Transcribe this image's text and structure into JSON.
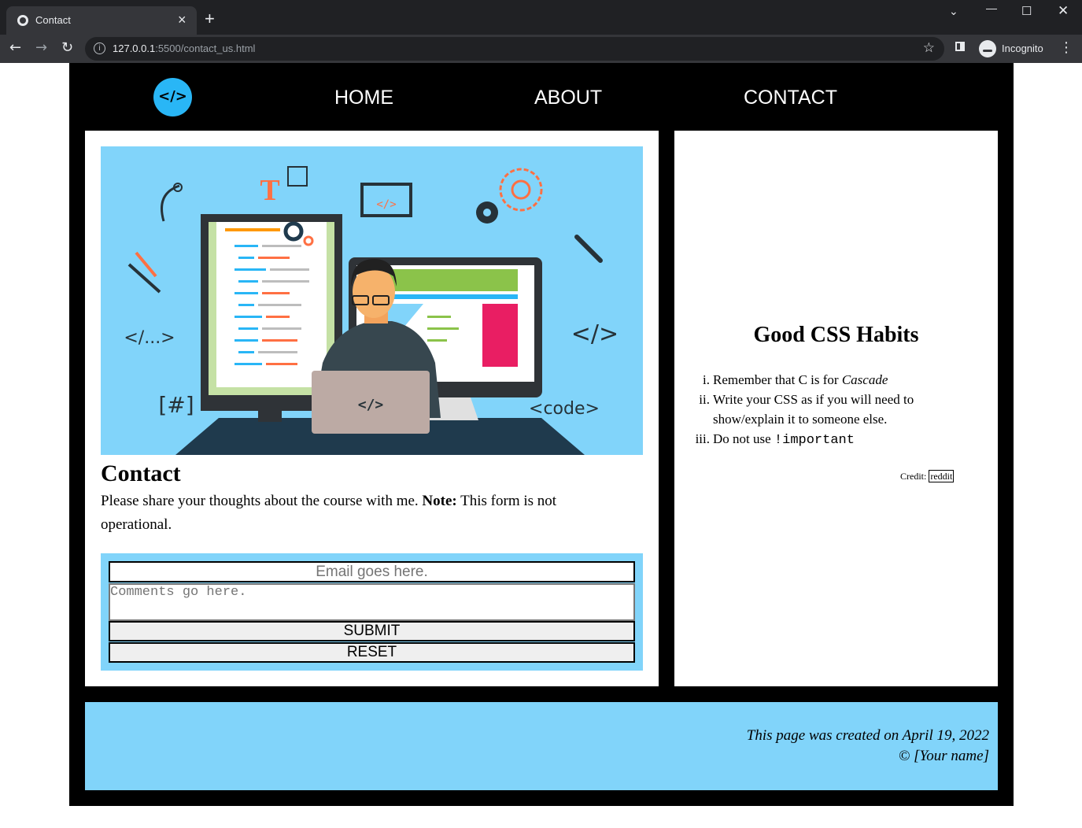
{
  "browser": {
    "tab_title": "Contact",
    "tab_close": "×",
    "new_tab": "+",
    "url_host": "127.0.0.1",
    "url_rest": ":5500/contact_us.html",
    "profile_label": "Incognito"
  },
  "nav": {
    "logo_text": "</>",
    "links": [
      "HOME",
      "ABOUT",
      "CONTACT"
    ]
  },
  "main": {
    "hero_labels": {
      "t": "T",
      "ellipsis_tag": "</...>",
      "hash": "[#]",
      "code": "<code>",
      "close_tag": "</>",
      "laptop": "</>",
      "monitor_tag": "</>"
    },
    "heading": "Contact",
    "intro_text": "Please share your thoughts about the course with me. ",
    "intro_note": "Note:",
    "intro_rest": " This form is not operational.",
    "form": {
      "email_placeholder": "Email goes here.",
      "comments_placeholder": "Comments go here.",
      "submit_label": "SUBMIT",
      "reset_label": "RESET"
    }
  },
  "sidebar": {
    "heading": "Good CSS Habits",
    "habits": [
      {
        "num": "i.",
        "text": "Remember that C is for ",
        "em": "Cascade"
      },
      {
        "num": "ii.",
        "text": "Write your CSS as if you will need to show/explain it to someone else."
      },
      {
        "num": "iii.",
        "text": "Do not use ",
        "code": "!important"
      }
    ],
    "credit_label": "Credit:",
    "credit_link": "reddit"
  },
  "footer": {
    "created_line": "This page was created on April 19, 2022",
    "copyright_line": "© [Your name]"
  },
  "colors": {
    "accent_blue": "#81d4fa",
    "logo_blue": "#29b6f6",
    "page_black": "#000000"
  }
}
